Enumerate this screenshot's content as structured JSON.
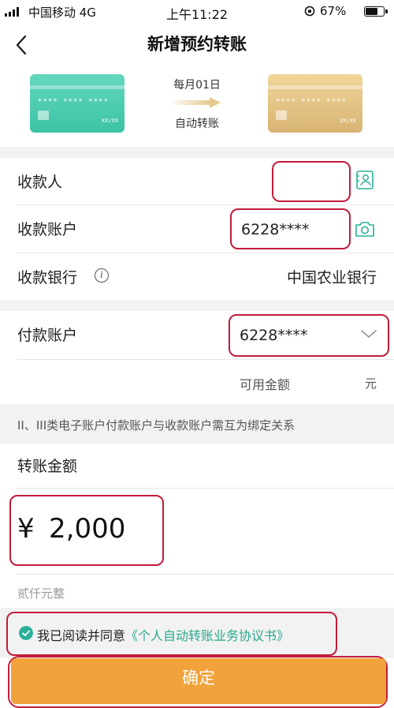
{
  "status_bar": {
    "carrier": "中国移动  4G",
    "time": "上午11:22",
    "battery": "67%"
  },
  "nav": {
    "title": "新增预约转账",
    "back_icon": "chevron-left-icon"
  },
  "flow": {
    "schedule": "每月01日",
    "mode": "自动转账",
    "card_number_mask": "**** **** ****",
    "card_expiry": "XX/XX"
  },
  "payee": {
    "label": "收款人",
    "name_value": "",
    "account_label": "收款账户",
    "account_value": "6228****",
    "bank_label": "收款银行",
    "bank_value": "中国农业银行"
  },
  "payer": {
    "account_label": "付款账户",
    "account_value": "6228****",
    "available_label": "可用金额",
    "available_unit": "元"
  },
  "notice": "II、III类电子账户付款账户与收款账户需互为绑定关系",
  "amount": {
    "label": "转账金额",
    "currency": "¥",
    "value": "2,000",
    "in_words": "贰仟元整"
  },
  "agreement": {
    "text": "我已阅读并同意",
    "link": "《个人自动转账业务协议书》"
  },
  "confirm_label": "确定",
  "colors": {
    "accent_green": "#2cb09a",
    "confirm_orange": "#f2a23a",
    "annotation_red": "#c21c3a"
  }
}
